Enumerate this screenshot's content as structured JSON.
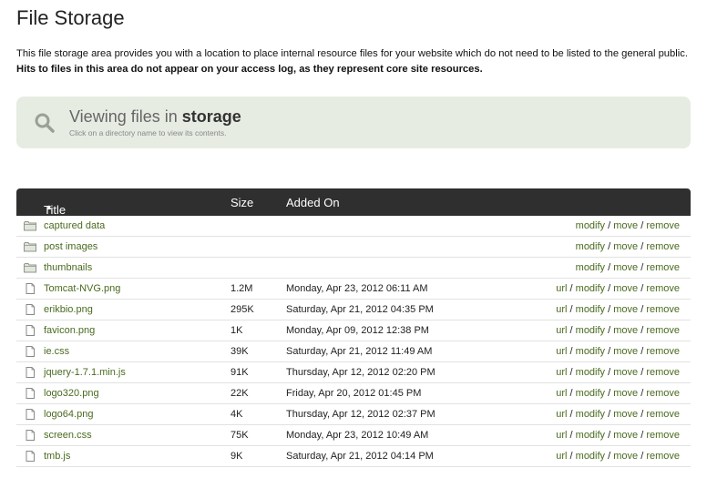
{
  "page": {
    "title": "File Storage",
    "intro_line1": "This file storage area provides you with a location to place internal resource files for your website which do not need to be listed to the general public.",
    "intro_line2": "Hits to files in this area do not appear on your access log, as they represent core site resources."
  },
  "viewing": {
    "prefix": "Viewing files in",
    "directory": "storage",
    "hint": "Click on a directory name to view its contents.",
    "icon": "search-icon"
  },
  "table": {
    "headers": {
      "title": "Title",
      "sort_arrow": "▲",
      "size": "Size",
      "added": "Added On"
    },
    "action_labels": {
      "url": "url",
      "modify": "modify",
      "move": "move",
      "remove": "remove",
      "sep": " / "
    },
    "rows": [
      {
        "type": "folder",
        "name": "captured data",
        "size": "",
        "added": ""
      },
      {
        "type": "folder",
        "name": "post images",
        "size": "",
        "added": ""
      },
      {
        "type": "folder",
        "name": "thumbnails",
        "size": "",
        "added": ""
      },
      {
        "type": "file",
        "name": "Tomcat-NVG.png",
        "size": "1.2M",
        "added": "Monday, Apr 23, 2012 06:11 AM"
      },
      {
        "type": "file",
        "name": "erikbio.png",
        "size": "295K",
        "added": "Saturday, Apr 21, 2012 04:35 PM"
      },
      {
        "type": "file",
        "name": "favicon.png",
        "size": "1K",
        "added": "Monday, Apr 09, 2012 12:38 PM"
      },
      {
        "type": "file",
        "name": "ie.css",
        "size": "39K",
        "added": "Saturday, Apr 21, 2012 11:49 AM"
      },
      {
        "type": "file",
        "name": "jquery-1.7.1.min.js",
        "size": "91K",
        "added": "Thursday, Apr 12, 2012 02:20 PM"
      },
      {
        "type": "file",
        "name": "logo320.png",
        "size": "22K",
        "added": "Friday, Apr 20, 2012 01:45 PM"
      },
      {
        "type": "file",
        "name": "logo64.png",
        "size": "4K",
        "added": "Thursday, Apr 12, 2012 02:37 PM"
      },
      {
        "type": "file",
        "name": "screen.css",
        "size": "75K",
        "added": "Monday, Apr 23, 2012 10:49 AM"
      },
      {
        "type": "file",
        "name": "tmb.js",
        "size": "9K",
        "added": "Saturday, Apr 21, 2012 04:14 PM"
      }
    ]
  },
  "colors": {
    "link": "#4a6a1f",
    "header_bg": "#2f2f2f",
    "panel_bg": "#e7ece3"
  }
}
